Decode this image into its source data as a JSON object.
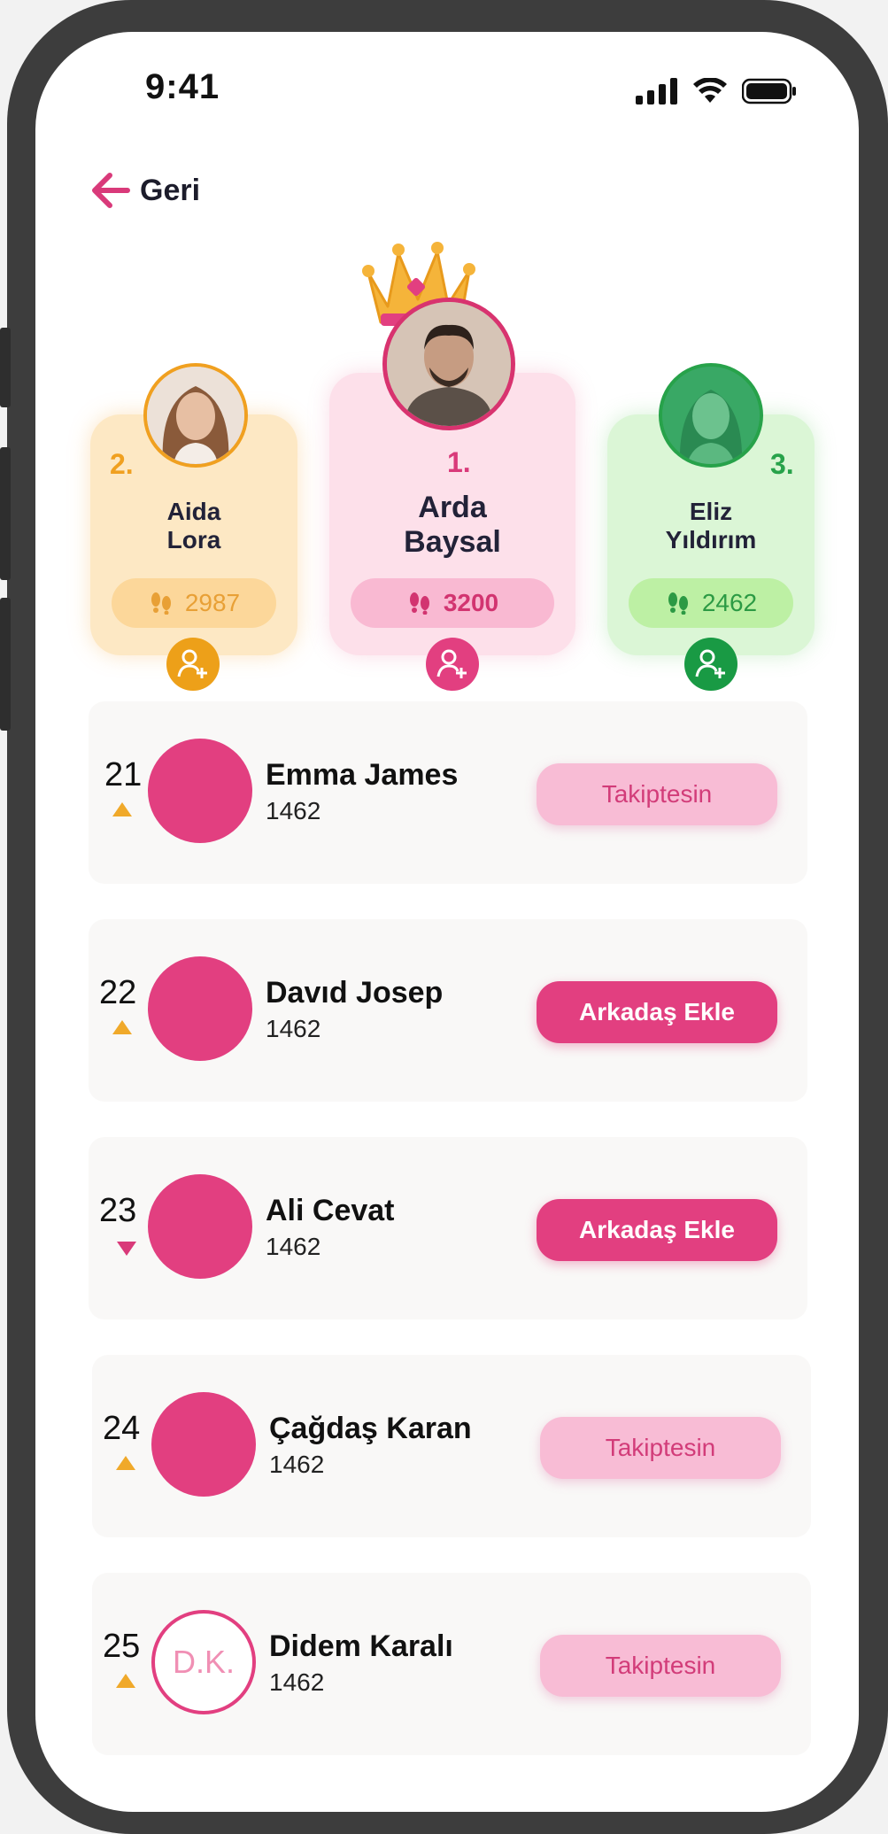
{
  "status_bar": {
    "time": "9:41"
  },
  "nav": {
    "back_label": "Geri"
  },
  "podium": {
    "first": {
      "rank": "1.",
      "first_name": "Arda",
      "last_name": "Baysal",
      "score": "3200",
      "accent": "#e23f80"
    },
    "second": {
      "rank": "2.",
      "first_name": "Aida",
      "last_name": "Lora",
      "score": "2987",
      "accent": "#f0a020"
    },
    "third": {
      "rank": "3.",
      "first_name": "Eliz",
      "last_name": "Yıldırım",
      "score": "2462",
      "accent": "#27a24a"
    }
  },
  "leaderboard": [
    {
      "rank": "21",
      "trend": "up",
      "name": "Emma James",
      "score": "1462",
      "button": "Takiptesin",
      "button_type": "following"
    },
    {
      "rank": "22",
      "trend": "up",
      "name": "Davıd Josep",
      "score": "1462",
      "button": "Arkadaş Ekle",
      "button_type": "add"
    },
    {
      "rank": "23",
      "trend": "down",
      "name": "Ali Cevat",
      "score": "1462",
      "button": "Arkadaş Ekle",
      "button_type": "add"
    },
    {
      "rank": "24",
      "trend": "up",
      "name": "Çağdaş Karan",
      "score": "1462",
      "button": "Takiptesin",
      "button_type": "following"
    },
    {
      "rank": "25",
      "trend": "up",
      "name": "Didem Karalı",
      "score": "1462",
      "button": "Takiptesin",
      "button_type": "following",
      "initials": "D.K."
    }
  ],
  "colors": {
    "brand": "#e23f80",
    "gold": "#f0a020",
    "green": "#27a24a"
  }
}
